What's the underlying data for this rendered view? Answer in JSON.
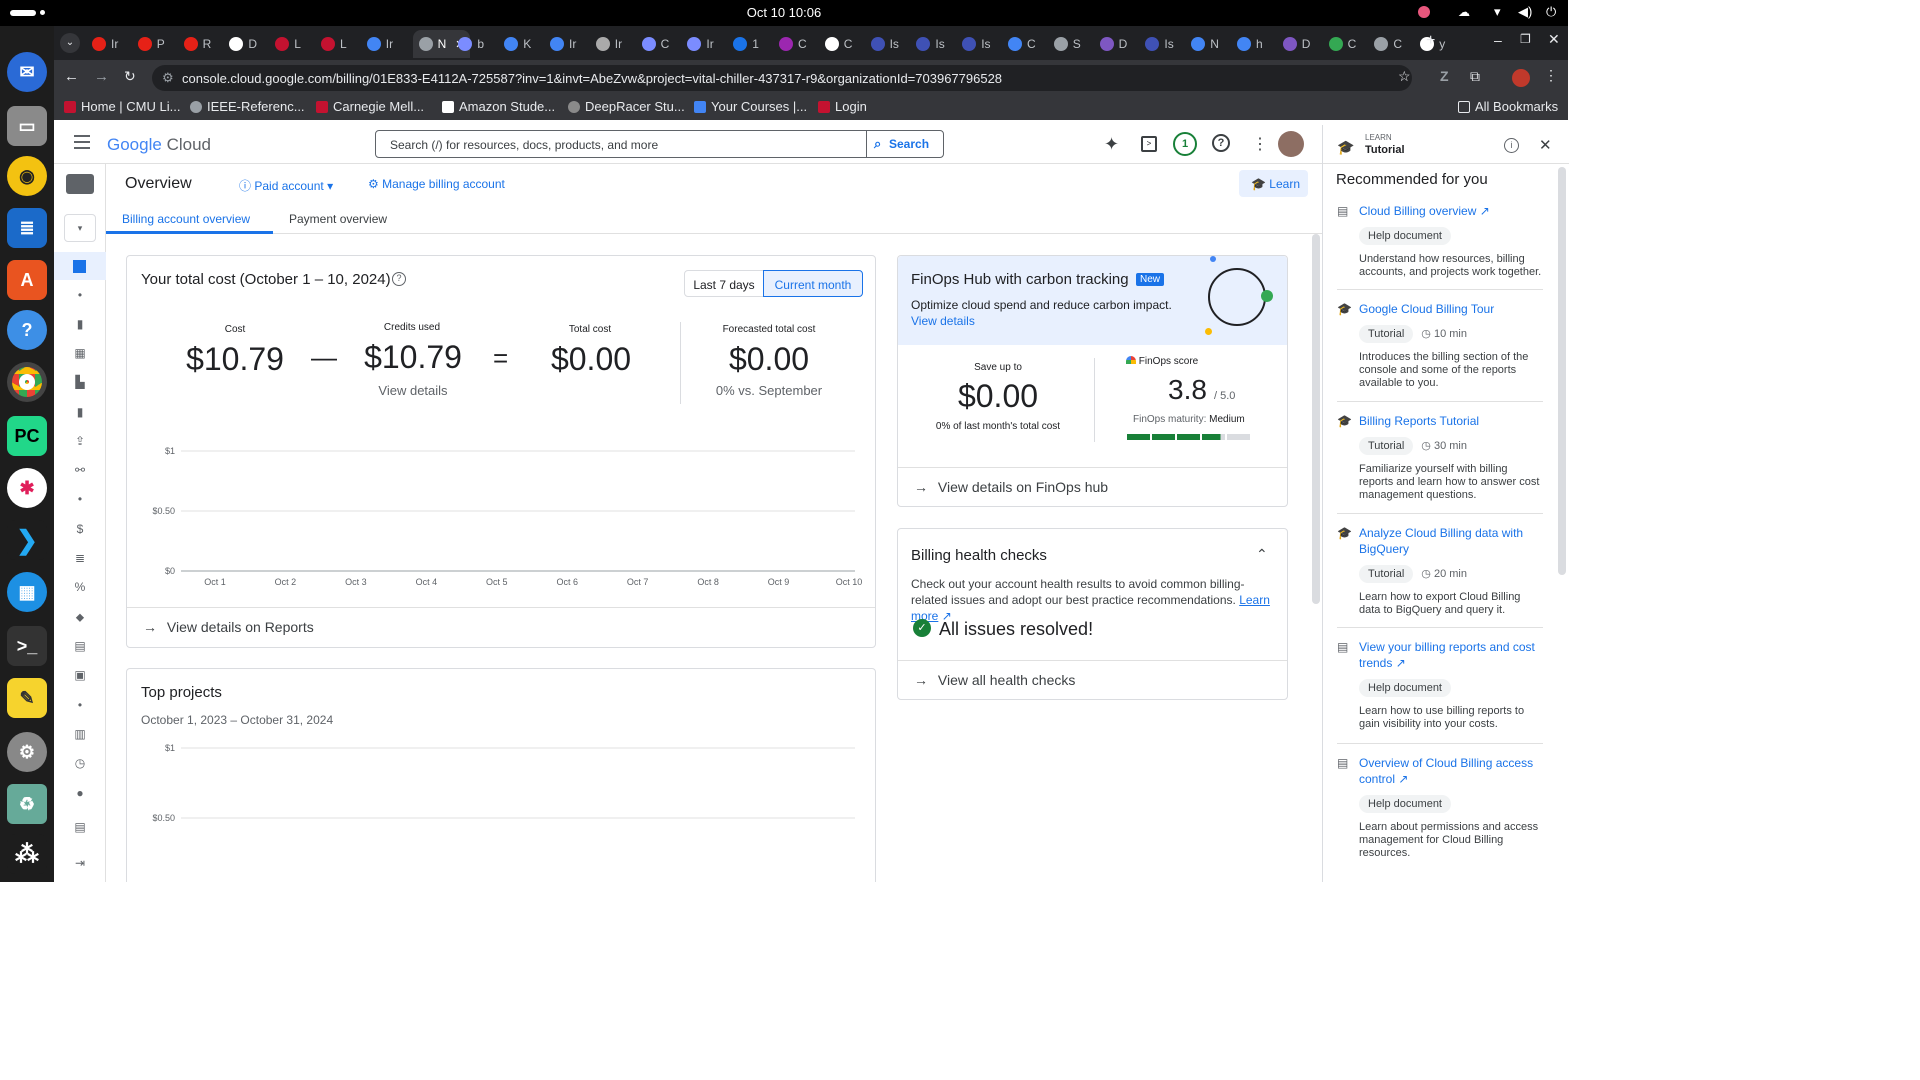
{
  "os": {
    "clock": "Oct 10  10:06"
  },
  "browser": {
    "tabs": [
      "Ir",
      "P",
      "R",
      "D",
      "L",
      "L",
      "Ir",
      "N",
      "b",
      "K",
      "Ir",
      "Ir",
      "C",
      "Ir",
      "1",
      "C",
      "C",
      "Is",
      "Is",
      "Is",
      "C",
      "S",
      "D",
      "Is",
      "N",
      "h",
      "D",
      "C",
      "C",
      "y"
    ],
    "url": "console.cloud.google.com/billing/01E833-E4112A-725587?inv=1&invt=AbeZvw&project=vital-chiller-437317-r9&organizationId=703967796528",
    "bookmarks": [
      "Home | CMU Li...",
      "IEEE-Referenc...",
      "Carnegie Mell...",
      "Amazon Stude...",
      "DeepRacer Stu...",
      "Your Courses |...",
      "Login"
    ],
    "all_bookmarks": "All Bookmarks"
  },
  "header": {
    "logo_google": "Google",
    "logo_cloud": "Cloud",
    "search_placeholder": "Search (/) for resources, docs, products, and more",
    "search_button": "Search",
    "notif_count": "1"
  },
  "subheader": {
    "title": "Overview",
    "paid_account": "Paid account",
    "manage": "Manage billing account",
    "learn": "Learn"
  },
  "tabs": [
    "Billing account overview",
    "Payment overview"
  ],
  "total_cost": {
    "title": "Your total cost (October 1 – 10, 2024)",
    "range_7": "Last 7 days",
    "range_month": "Current month",
    "cost_label": "Cost",
    "cost_value": "$10.79",
    "minus": "—",
    "credits_label": "Credits used",
    "credits_value": "$10.79",
    "credits_link": "View details",
    "equals": "=",
    "total_label": "Total cost",
    "total_value": "$0.00",
    "forecast_label": "Forecasted total cost",
    "forecast_value": "$0.00",
    "forecast_note": "0% vs. September",
    "footer": "View details on Reports"
  },
  "chart_data": {
    "type": "bar",
    "categories": [
      "Oct 1",
      "Oct 2",
      "Oct 3",
      "Oct 4",
      "Oct 5",
      "Oct 6",
      "Oct 7",
      "Oct 8",
      "Oct 9",
      "Oct 10"
    ],
    "values": [
      0,
      0,
      0,
      0,
      0,
      0,
      0,
      0,
      0,
      0
    ],
    "y_ticks": [
      "$1",
      "$0.50",
      "$0"
    ],
    "ylim": [
      0,
      1
    ]
  },
  "top_projects": {
    "title": "Top projects",
    "range": "October 1, 2023 – October 31, 2024",
    "y_ticks": [
      "$1",
      "$0.50"
    ]
  },
  "finops": {
    "title": "FinOps Hub with carbon tracking",
    "badge": "New",
    "desc": "Optimize cloud spend and reduce carbon impact.",
    "link": "View details",
    "save_label": "Save up to",
    "save_value": "$0.00",
    "save_note": "0% of last month's total cost",
    "score_label": "FinOps score",
    "score_value": "3.8",
    "score_max": "/ 5.0",
    "maturity_label": "FinOps maturity:",
    "maturity_value": "Medium",
    "footer": "View details on FinOps hub"
  },
  "health": {
    "title": "Billing health checks",
    "desc": "Check out your account health results to avoid common billing-related issues and adopt our best practice recommendations.",
    "learn_more": "Learn more",
    "status": "All issues resolved!",
    "footer": "View all health checks"
  },
  "panel": {
    "eyebrow": "LEARN",
    "title": "Tutorial",
    "heading": "Recommended for you",
    "items": [
      {
        "title": "Cloud Billing overview",
        "chip": "Help document",
        "duration": "",
        "desc": "Understand how resources, billing accounts, and projects work together."
      },
      {
        "title": "Google Cloud Billing Tour",
        "chip": "Tutorial",
        "duration": "10 min",
        "desc": "Introduces the billing section of the console and some of the reports available to you."
      },
      {
        "title": "Billing Reports Tutorial",
        "chip": "Tutorial",
        "duration": "30 min",
        "desc": "Familiarize yourself with billing reports and learn how to answer cost management questions."
      },
      {
        "title": "Analyze Cloud Billing data with BigQuery",
        "chip": "Tutorial",
        "duration": "20 min",
        "desc": "Learn how to export Cloud Billing data to BigQuery and query it."
      },
      {
        "title": "View your billing reports and cost trends",
        "chip": "Help document",
        "duration": "",
        "desc": "Learn how to use billing reports to gain visibility into your costs."
      },
      {
        "title": "Overview of Cloud Billing access control",
        "chip": "Help document",
        "duration": "",
        "desc": "Learn about permissions and access management for Cloud Billing resources."
      }
    ]
  }
}
